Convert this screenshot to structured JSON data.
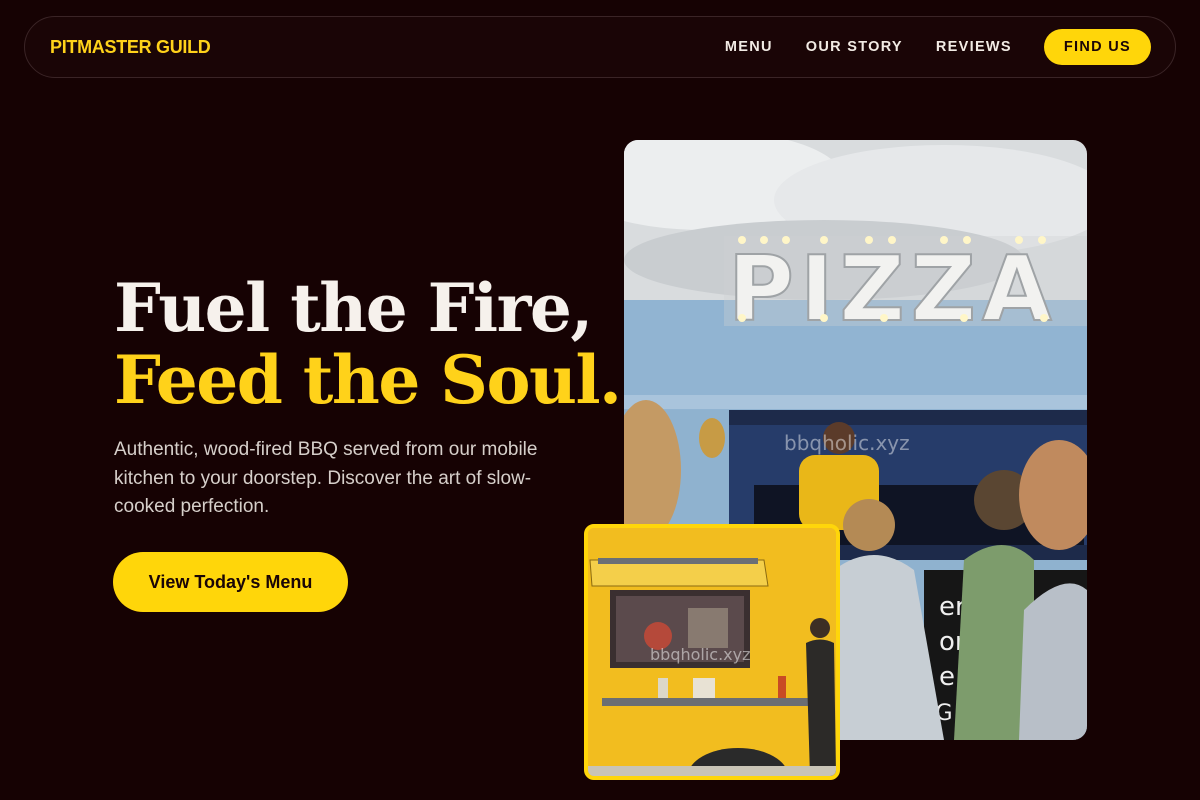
{
  "nav": {
    "logo": "PITMASTER GUILD",
    "links": [
      {
        "label": "MENU"
      },
      {
        "label": "OUR STORY"
      },
      {
        "label": "REVIEWS"
      }
    ],
    "cta_label": "FIND US"
  },
  "hero": {
    "title_line1": "Fuel the Fire,",
    "title_line2": "Feed the Soul.",
    "description": "Authentic, wood-fired BBQ served from our mobile kitchen to your doorstep. Discover the art of slow-cooked perfection.",
    "cta_label": "View Today's Menu"
  },
  "images": {
    "main_sign": "PIZZA",
    "main_watermark": "bbqholic.xyz",
    "small_watermark": "bbqholic.xyz"
  },
  "colors": {
    "background": "#160203",
    "accent": "#ffd60a"
  }
}
